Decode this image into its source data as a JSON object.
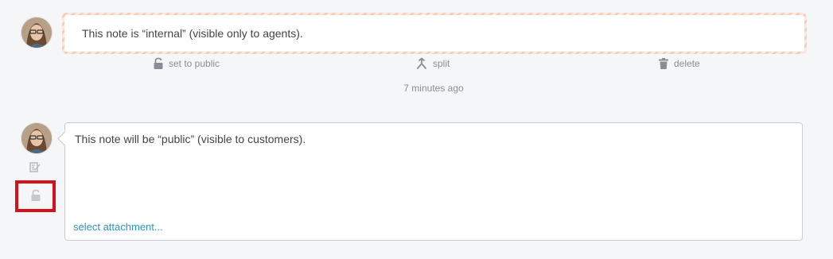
{
  "internal_note": {
    "text": "This note is “internal” (visible only to agents).",
    "actions": {
      "set_public": "set to public",
      "split": "split",
      "delete": "delete"
    },
    "timestamp": "7 minutes ago"
  },
  "compose": {
    "text": "This note will be “public” (visible to customers).",
    "attachment_link": "select attachment..."
  },
  "icons": {
    "set_public": "unlock-icon",
    "split": "split-icon",
    "delete": "trash-icon",
    "side_edit": "edit-icon",
    "side_visibility": "unlock-icon"
  },
  "colors": {
    "internal_stripe": "#f5cdb8",
    "link": "#2c94c8",
    "highlight": "#d3121b"
  }
}
